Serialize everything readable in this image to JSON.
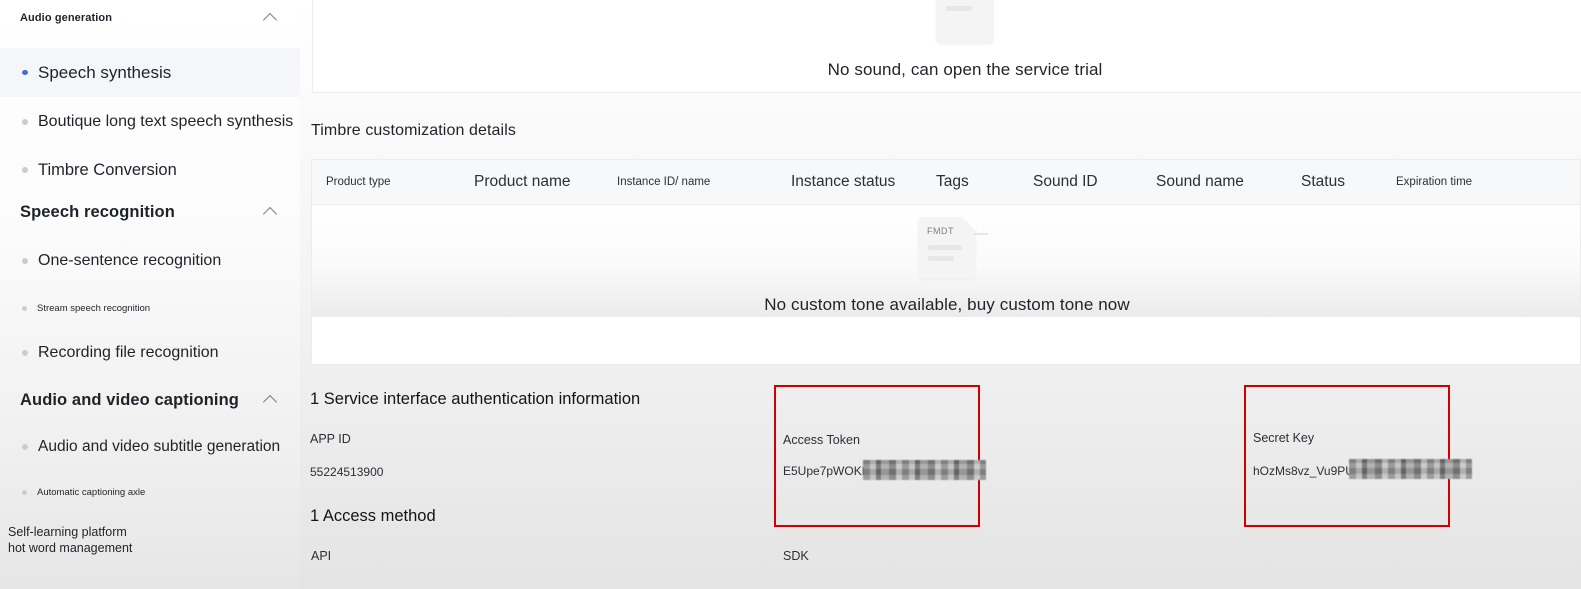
{
  "sidebar": {
    "groups": [
      {
        "name": "audio-generation",
        "label": "Audio generation",
        "collapse_icon": "chevron-up-icon",
        "items": [
          {
            "label": "Speech synthesis",
            "active": true
          },
          {
            "label": "Boutique long text speech synthesis",
            "active": false
          },
          {
            "label": "Timbre Conversion",
            "active": false
          }
        ]
      },
      {
        "name": "speech-recognition",
        "label": "Speech recognition",
        "collapse_icon": "chevron-up-icon",
        "items": [
          {
            "label": "One-sentence recognition",
            "active": false
          },
          {
            "label": "Stream speech recognition",
            "active": false
          },
          {
            "label": "Recording file recognition",
            "active": false
          }
        ]
      },
      {
        "name": "audio-and-video-captioning",
        "label": "Audio and video captioning",
        "collapse_icon": "chevron-up-icon",
        "items": [
          {
            "label": "Audio and video subtitle generation",
            "active": false
          },
          {
            "label": "Automatic captioning axle",
            "active": false
          }
        ]
      }
    ],
    "footer_label": "Self-learning platform hot word management"
  },
  "main": {
    "top_panel": {
      "empty_text": "No sound, can open the service trial",
      "icon": "document-placeholder-icon"
    },
    "timbre_section": {
      "title": "Timbre customization details",
      "table": {
        "columns": [
          "Product type",
          "Product name",
          "Instance ID/ name",
          "Instance status",
          "Tags",
          "Sound ID",
          "Sound name",
          "Status",
          "Expiration time"
        ],
        "rows": [],
        "empty_text": "No custom tone available, buy custom tone now",
        "empty_icon_label": "FMDT",
        "empty_icon": "document-placeholder-icon"
      }
    },
    "auth_section": {
      "title": "1 Service interface authentication information",
      "app_id_label": "APP ID",
      "app_id_value": "55224513900",
      "access_token_label": "Access Token",
      "access_token_value": "E5Upe7pWOKE-i",
      "access_token_masked": true,
      "secret_key_label": "Secret Key",
      "secret_key_value": "hOzMs8vz_Vu9PUhF",
      "secret_key_masked": true,
      "highlight_color": "#d00000"
    },
    "access_section": {
      "title": "1 Access method",
      "api_label": "API",
      "sdk_label": "SDK"
    }
  }
}
